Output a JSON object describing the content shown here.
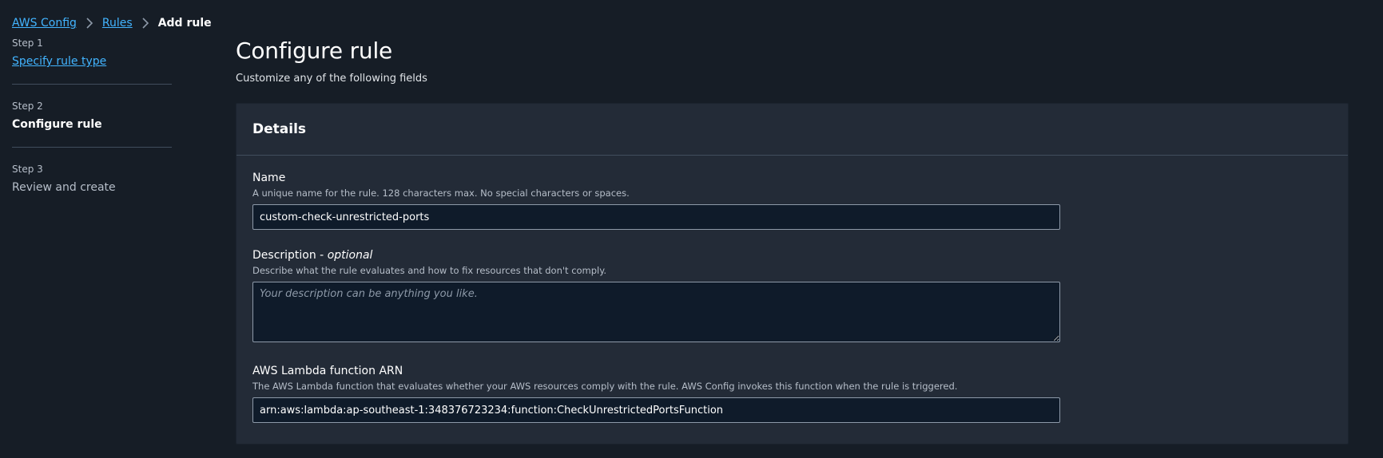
{
  "breadcrumb": {
    "items": [
      "AWS Config",
      "Rules"
    ],
    "current": "Add rule"
  },
  "steps": [
    {
      "label": "Step 1",
      "title": "Specify rule type"
    },
    {
      "label": "Step 2",
      "title": "Configure rule"
    },
    {
      "label": "Step 3",
      "title": "Review and create"
    }
  ],
  "header": {
    "title": "Configure rule",
    "subtitle": "Customize any of the following fields"
  },
  "details": {
    "title": "Details",
    "name": {
      "label": "Name",
      "description": "A unique name for the rule. 128 characters max. No special characters or spaces.",
      "value": "custom-check-unrestricted-ports"
    },
    "description": {
      "label": "Description - ",
      "label_optional": "optional",
      "description": "Describe what the rule evaluates and how to fix resources that don't comply.",
      "value": "",
      "placeholder": "Your description can be anything you like."
    },
    "lambda_arn": {
      "label": "AWS Lambda function ARN",
      "description": "The AWS Lambda function that evaluates whether your AWS resources comply with the rule. AWS Config invokes this function when the rule is triggered.",
      "value": "arn:aws:lambda:ap-southeast-1:348376723234:function:CheckUnrestrictedPortsFunction"
    }
  },
  "colors": {
    "background": "#161d26",
    "panel": "#232b37",
    "link": "#42b4ff",
    "input_bg": "#0f1b2a",
    "input_border": "#8d99a8"
  }
}
